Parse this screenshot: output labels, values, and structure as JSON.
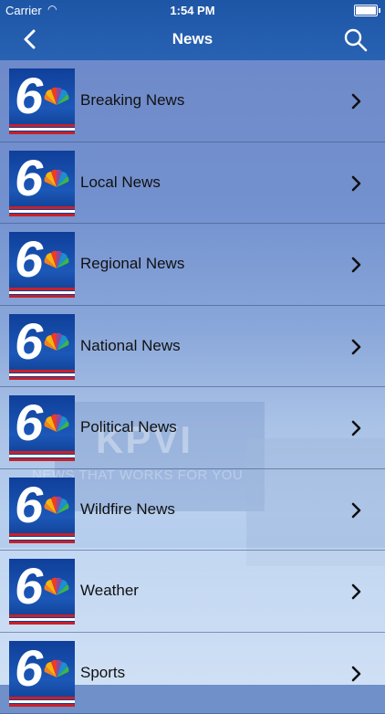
{
  "status": {
    "carrier": "Carrier",
    "time": "1:54 PM"
  },
  "nav": {
    "title": "News"
  },
  "items": [
    {
      "label": "Breaking News"
    },
    {
      "label": "Local News"
    },
    {
      "label": "Regional News"
    },
    {
      "label": "National News"
    },
    {
      "label": "Political News"
    },
    {
      "label": "Wildfire News"
    },
    {
      "label": "Weather"
    },
    {
      "label": "Sports"
    }
  ],
  "background": {
    "station": "KPVI",
    "tagline": "NEWS THAT WORKS FOR YOU"
  },
  "colors": {
    "navbar": "#2862b3",
    "accent_red": "#c8202a"
  }
}
